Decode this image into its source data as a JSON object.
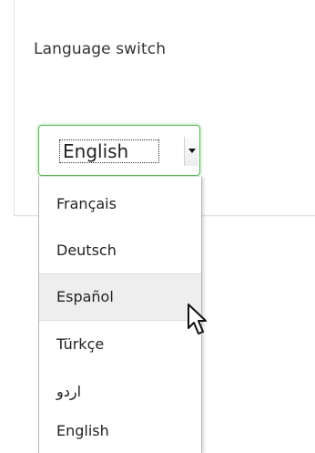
{
  "panel": {
    "title": "Language switch"
  },
  "language_select": {
    "selected": "English",
    "options": [
      "Français",
      "Deutsch",
      "Español",
      "Türkçe",
      "اردو",
      "English"
    ],
    "highlighted_option": "Español"
  },
  "colors": {
    "focus_border": "#5cb85c",
    "highlight_bg": "#eeeeee",
    "text": "#222222"
  },
  "icons": {
    "dropdown_arrow": "chevron-down-icon",
    "cursor": "mouse-pointer-icon"
  }
}
